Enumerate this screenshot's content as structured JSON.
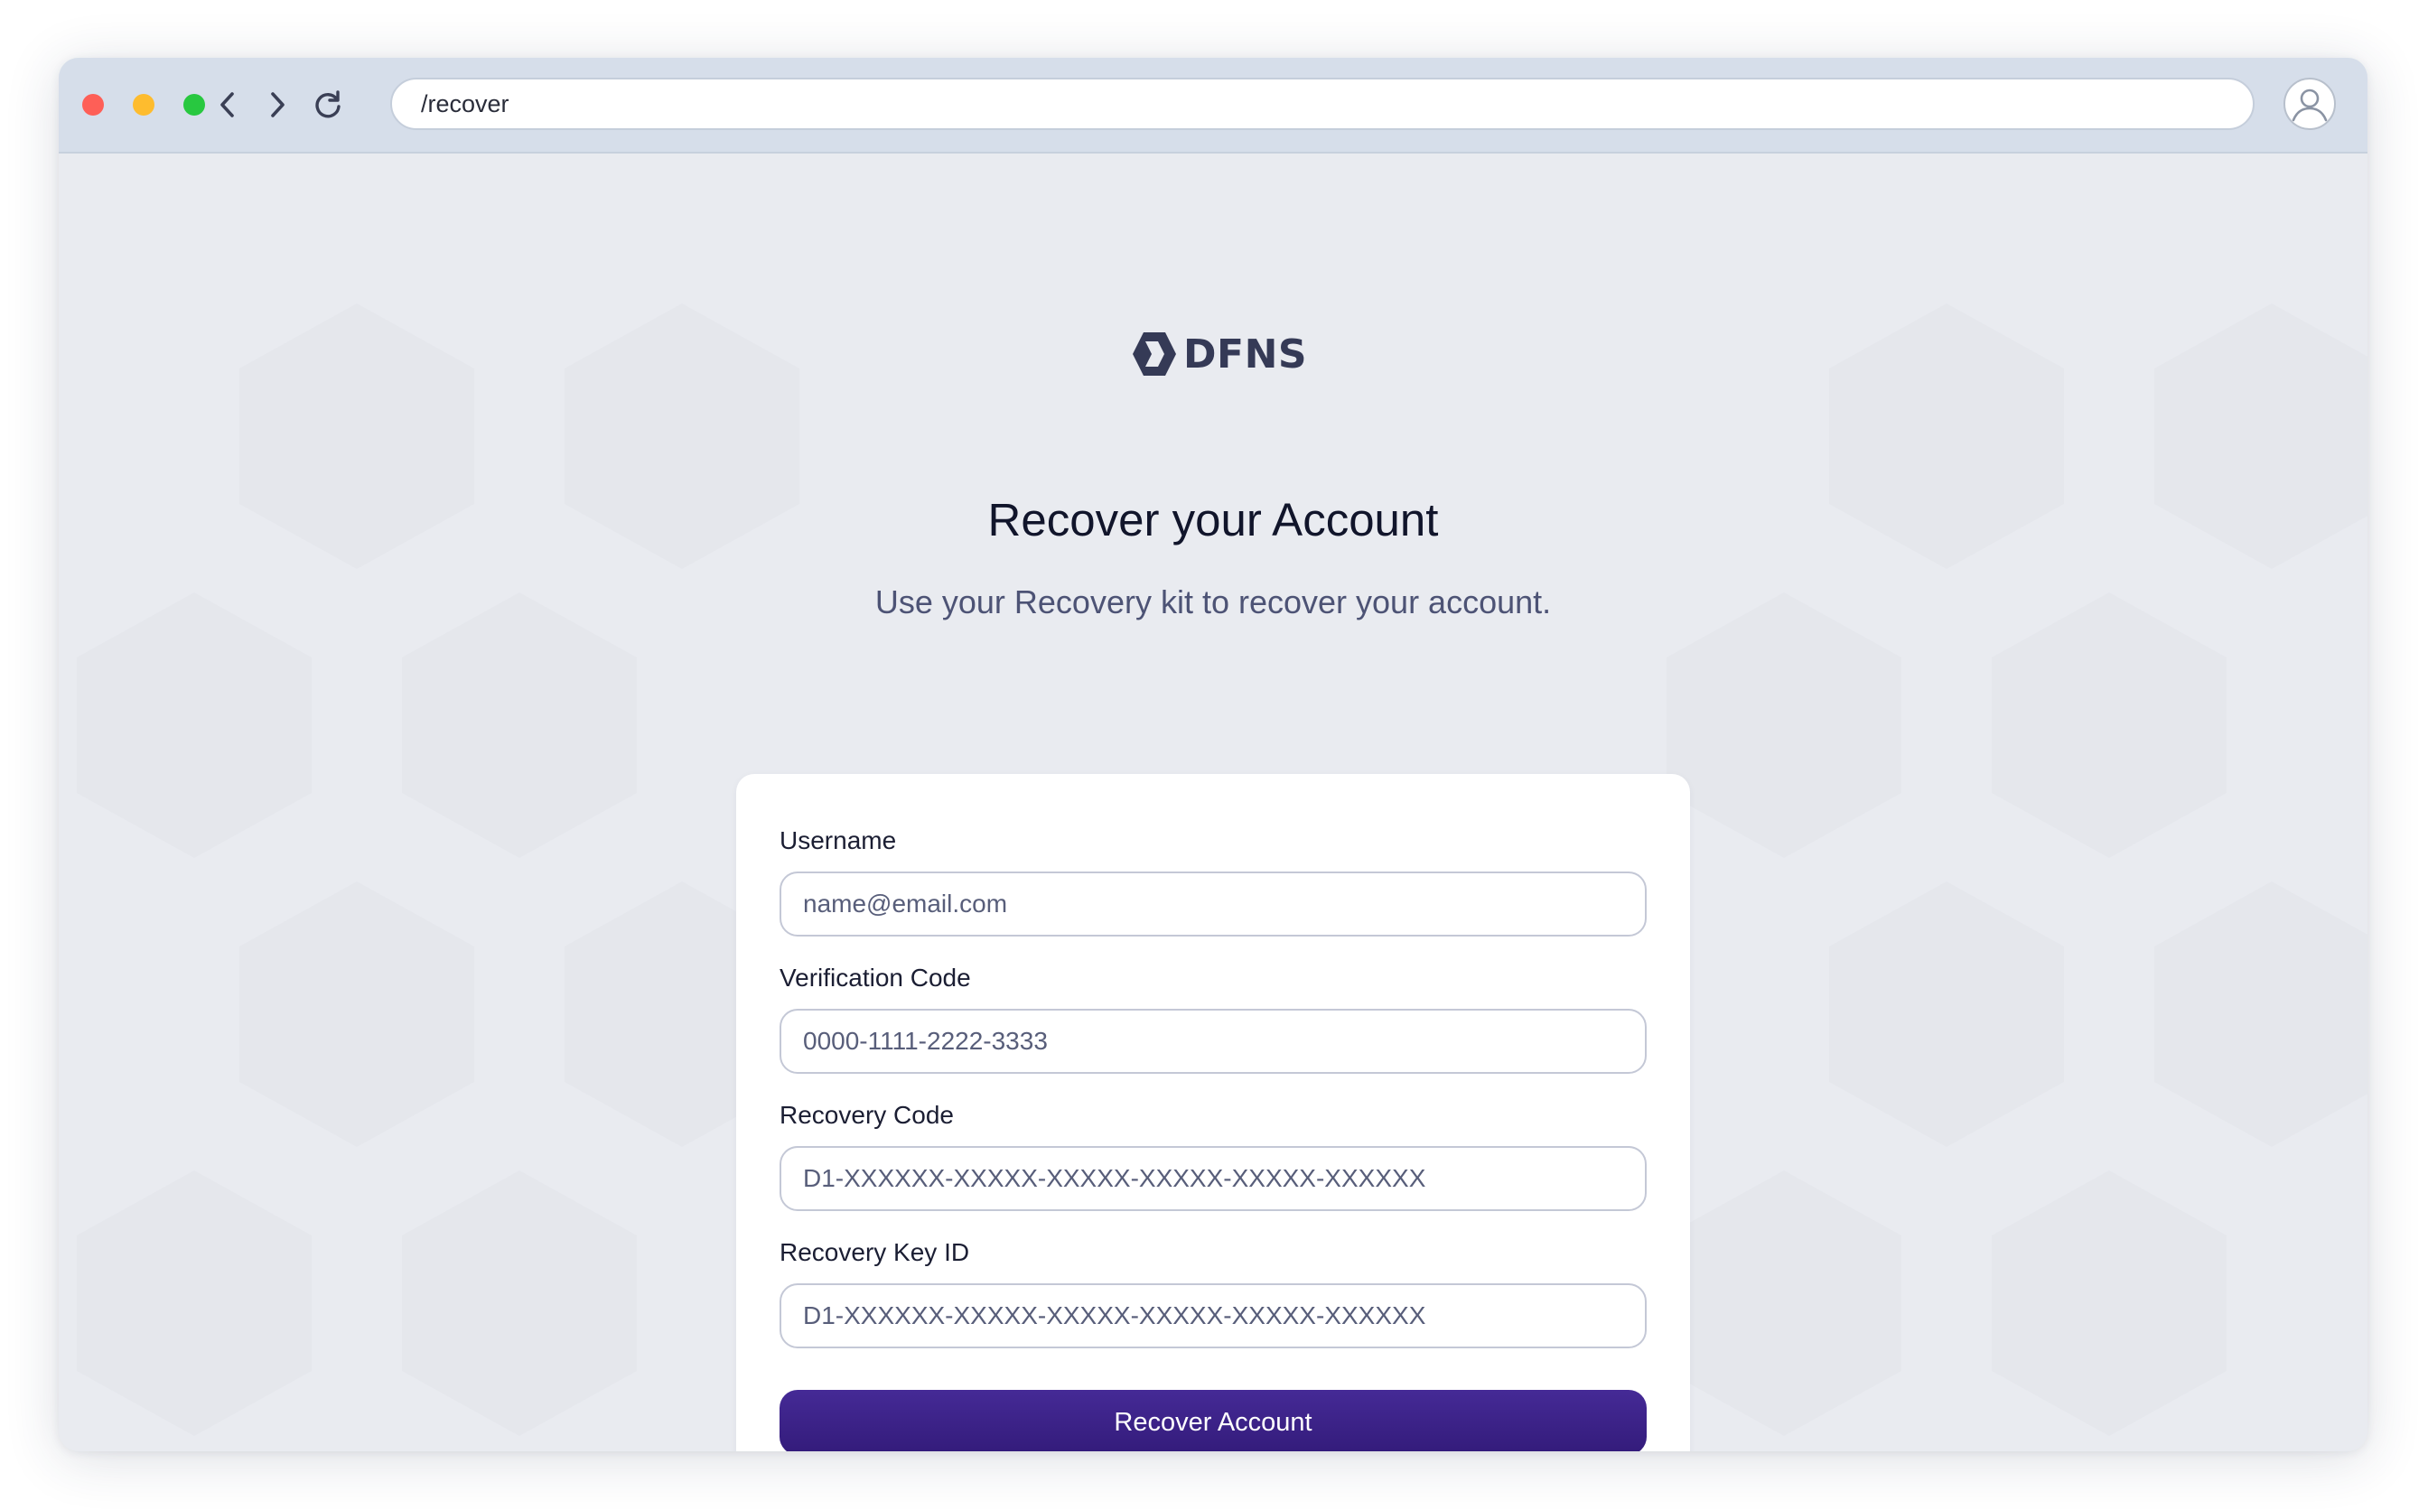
{
  "browser": {
    "url": "/recover"
  },
  "brand": {
    "name": "DFNS"
  },
  "page": {
    "title": "Recover your Account",
    "subtitle": "Use your Recovery kit to recover your account."
  },
  "form": {
    "username": {
      "label": "Username",
      "placeholder": "name@email.com"
    },
    "verification_code": {
      "label": "Verification Code",
      "placeholder": "0000-1111-2222-3333"
    },
    "recovery_code": {
      "label": "Recovery Code",
      "placeholder": "D1-XXXXXX-XXXXX-XXXXX-XXXXX-XXXXX-XXXXXX"
    },
    "recovery_key_id": {
      "label": "Recovery Key ID",
      "placeholder": "D1-XXXXXX-XXXXX-XXXXX-XXXXX-XXXXX-XXXXXX"
    },
    "submit_label": "Recover Account"
  },
  "colors": {
    "accent": "#3b2188",
    "page_background": "#e9ebf0",
    "toolbar_background": "#d6deea"
  }
}
